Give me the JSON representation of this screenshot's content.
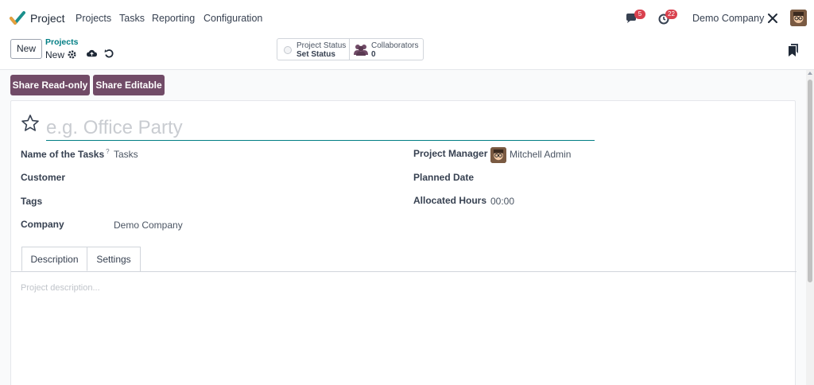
{
  "navbar": {
    "app_name": "Project",
    "menu": [
      {
        "label": "Projects"
      },
      {
        "label": "Tasks"
      },
      {
        "label": "Reporting"
      },
      {
        "label": "Configuration"
      }
    ],
    "messages_count": "5",
    "activities_count": "22",
    "company": "Demo Company",
    "icons": [
      "project-app-icon",
      "chat-icon",
      "clock-icon",
      "tools-icon",
      "user-avatar"
    ]
  },
  "control_panel": {
    "new_button": "New",
    "breadcrumb_parent": "Projects",
    "breadcrumb_current": "New",
    "icons": [
      "gear-icon",
      "cloud-upload-icon",
      "undo-icon",
      "bookmark-icon"
    ],
    "project_status": {
      "label": "Project Status",
      "value": "Set Status"
    },
    "collaborators": {
      "label": "Collaborators",
      "count": "0"
    }
  },
  "actions": {
    "share_read_only": "Share Read-only",
    "share_editable": "Share Editable"
  },
  "form": {
    "title_placeholder": "e.g. Office Party",
    "left_fields": [
      {
        "label": "Name of the Tasks",
        "help": "?",
        "value": "Tasks"
      },
      {
        "label": "Customer",
        "value": ""
      },
      {
        "label": "Tags",
        "value": ""
      },
      {
        "label": "Company",
        "value": "Demo Company"
      }
    ],
    "right_fields": [
      {
        "label": "Project Manager",
        "value": "Mitchell Admin"
      },
      {
        "label": "Planned Date",
        "value": ""
      },
      {
        "label": "Allocated Hours",
        "value": "00:00"
      }
    ],
    "tabs": [
      {
        "label": "Description",
        "active": true
      },
      {
        "label": "Settings",
        "active": false
      }
    ],
    "description_placeholder": "Project description..."
  },
  "colors": {
    "brand": "#714b67",
    "accent": "#017e84",
    "badge": "#d9414e"
  }
}
